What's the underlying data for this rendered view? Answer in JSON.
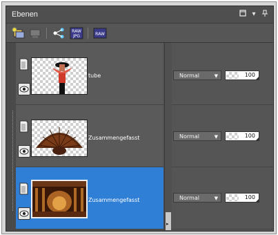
{
  "panel": {
    "title": "Ebenen",
    "title_buttons": [
      "maximize-icon",
      "menu-dropdown-icon",
      "pin-icon"
    ]
  },
  "toolbar": {
    "tools": [
      {
        "name": "new-layer-icon"
      },
      {
        "name": "layer-properties-icon"
      },
      {
        "name": "share-icon"
      },
      {
        "name": "raw-jpg-icon",
        "label_top": "RAW",
        "label_bottom": "JPG"
      },
      {
        "name": "raw-icon",
        "label": "RAW"
      }
    ]
  },
  "layers": [
    {
      "name": "tube",
      "blend": "Normal",
      "opacity": "100",
      "selected": false
    },
    {
      "name": "Zusammengefasst",
      "blend": "Normal",
      "opacity": "100",
      "selected": false
    },
    {
      "name": "Zusammengefasst",
      "blend": "Normal",
      "opacity": "100",
      "selected": true
    }
  ],
  "colors": {
    "selection": "#2f7fd6",
    "panel_bg": "#5a5a5a"
  }
}
